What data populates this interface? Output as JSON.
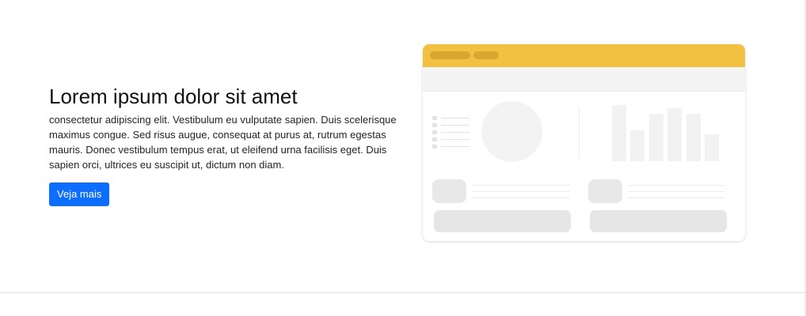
{
  "hero": {
    "title": "Lorem ipsum dolor sit amet",
    "paragraph": "consectetur adipiscing elit. Vestibulum eu vulputate sapien. Duis scelerisque maximus congue. Sed risus augue, consequat at purus at, rutrum egestas mauris. Donec vestibulum tempus erat, ut eleifend urna facilisis eget. Duis sapien orci, ultrices eu suscipit ut, dictum non diam.",
    "button_label": "Veja mais"
  },
  "colors": {
    "primary_button": "#0d6efd",
    "illustration_accent": "#f2c142",
    "illustration_placeholder": "#e8e8e8"
  },
  "illustration": {
    "type": "dashboard-placeholder-graphic",
    "list_rows": 5,
    "bar_levels": [
      1.0,
      0.55,
      0.85,
      0.95,
      0.85,
      0.48
    ]
  }
}
